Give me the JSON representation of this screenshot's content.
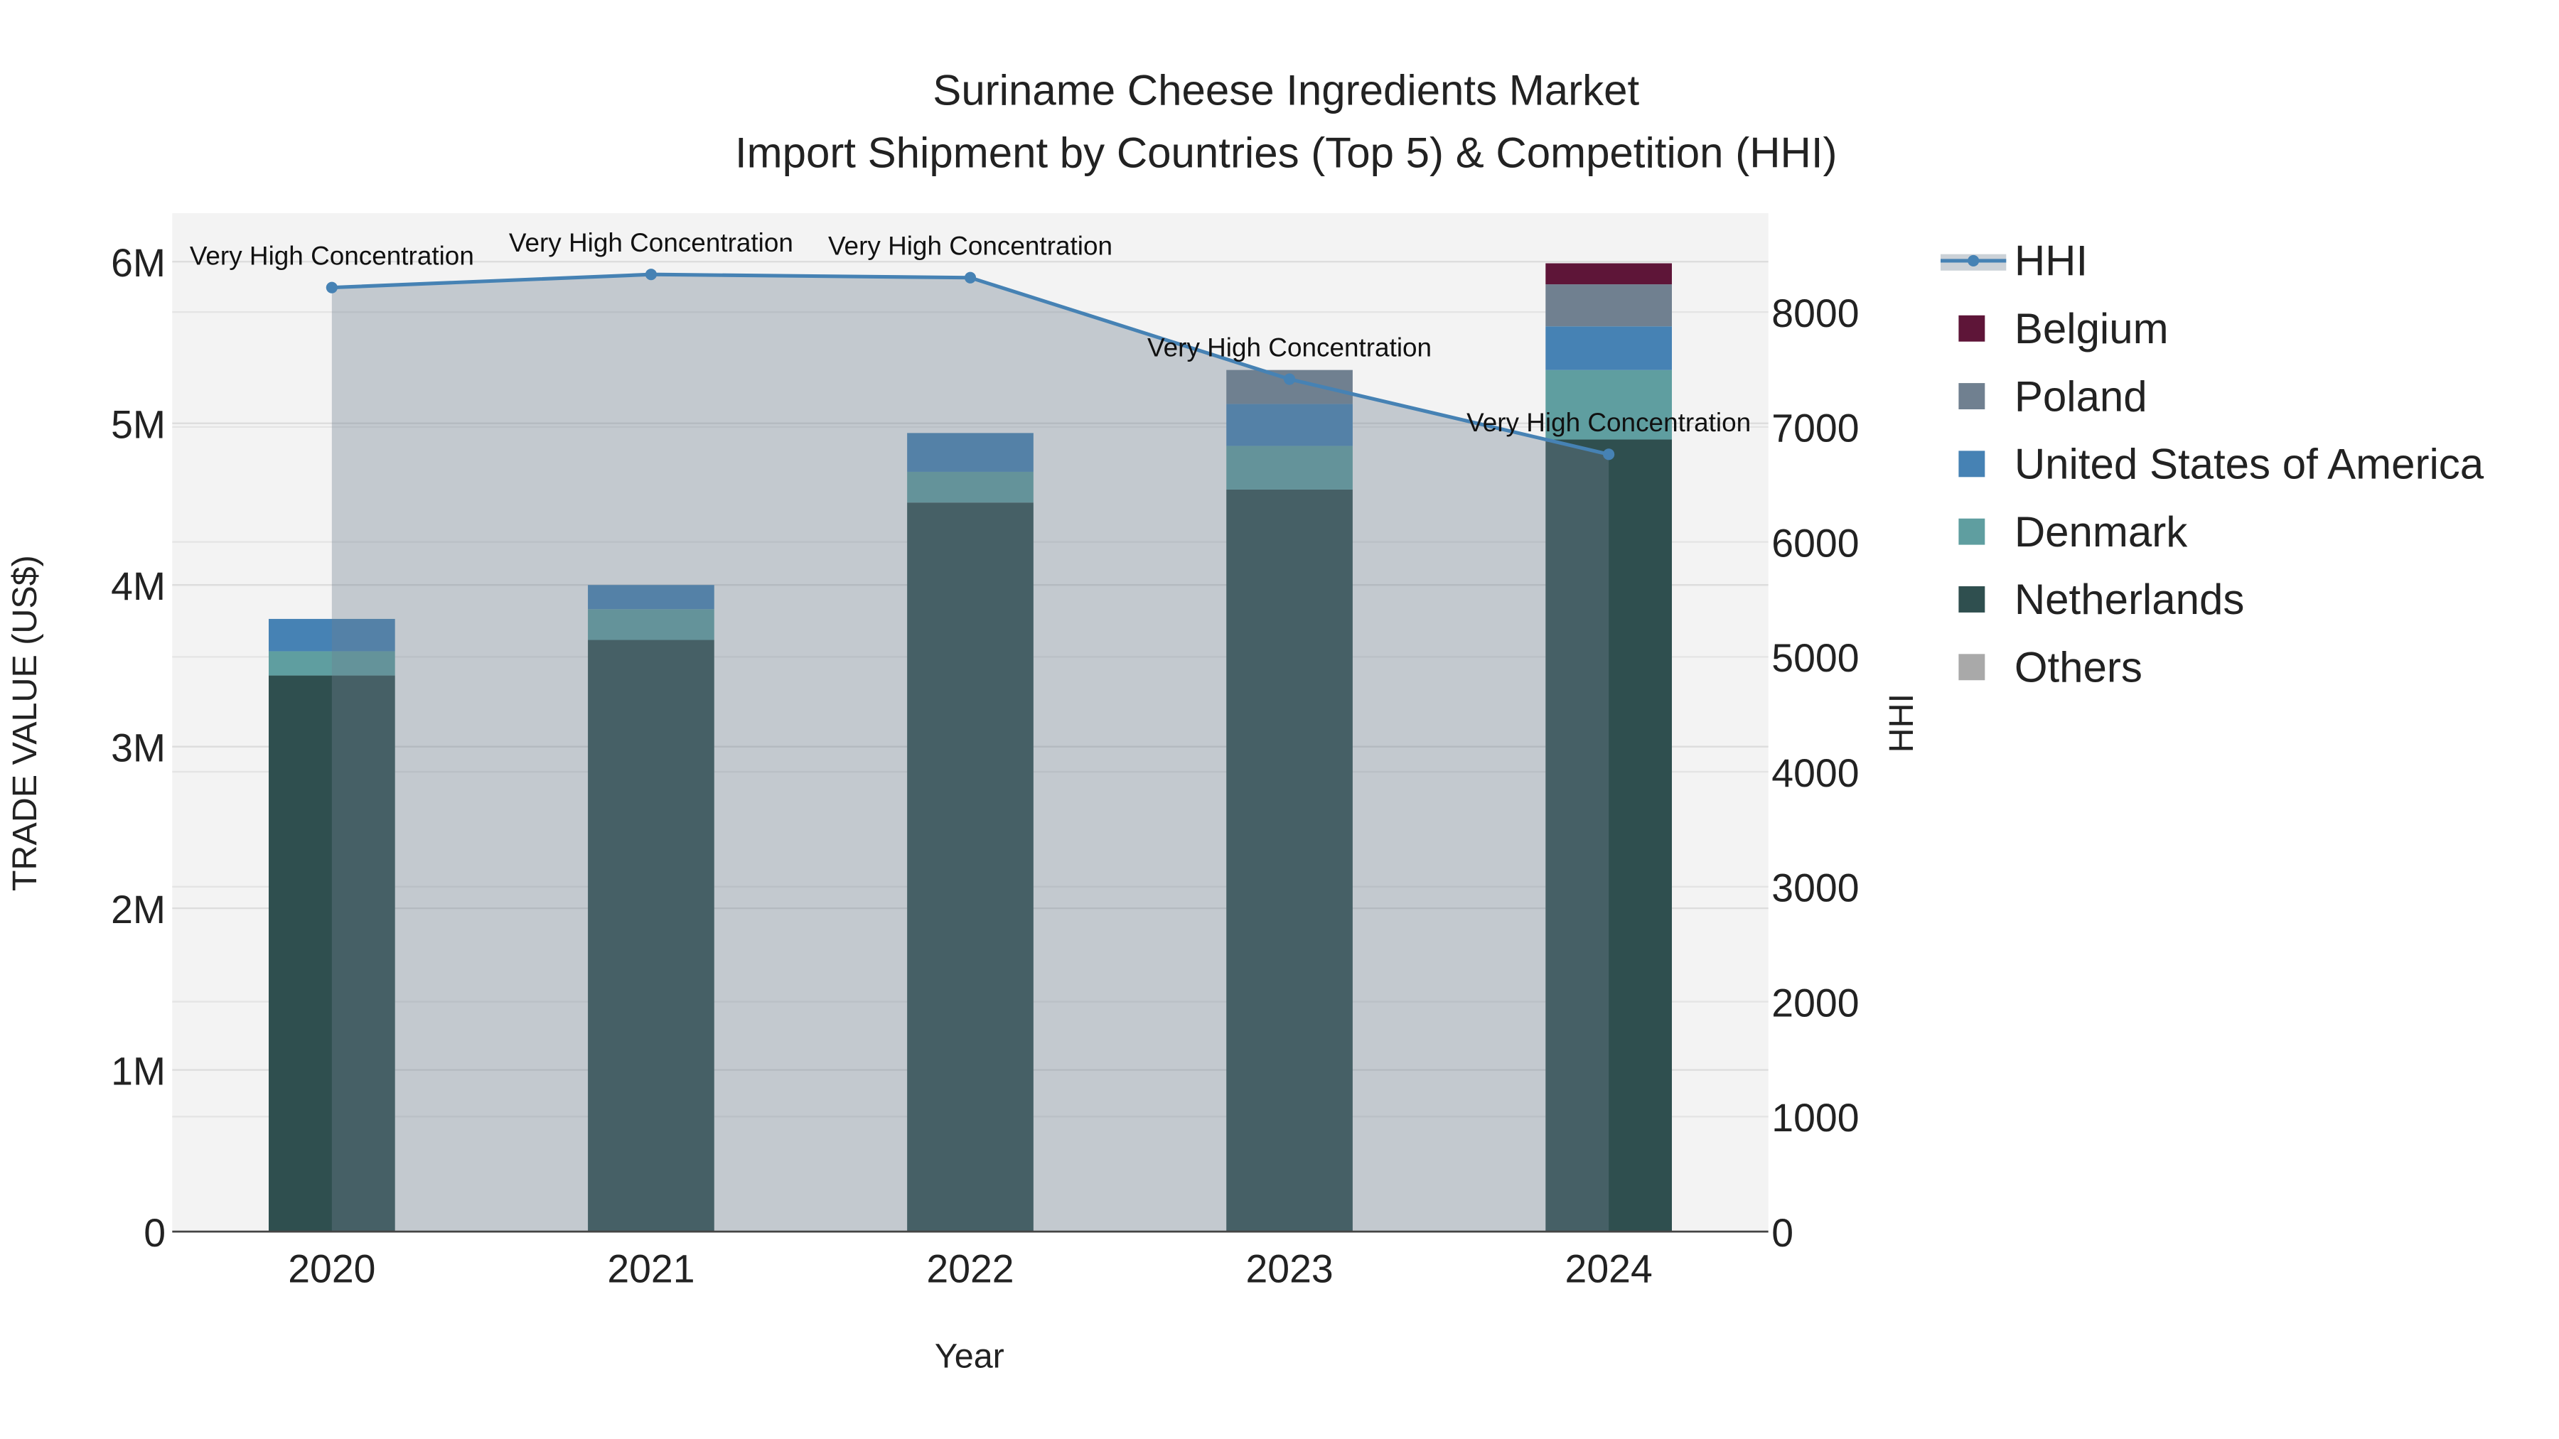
{
  "chart_data": {
    "type": "bar",
    "title": "Suriname Cheese Ingredients Market",
    "subtitle": "Import Shipment by Countries (Top 5) & Competition (HHI)",
    "xlabel": "Year",
    "ylabel": "TRADE VALUE (US$)",
    "y2label": "HHI",
    "barmode": "stack",
    "categories": [
      "2020",
      "2021",
      "2022",
      "2023",
      "2024"
    ],
    "ylim": [
      0,
      6300000
    ],
    "y2lim": [
      0,
      8860
    ],
    "yticks": [
      {
        "v": 0,
        "label": "0"
      },
      {
        "v": 1000000,
        "label": "1M"
      },
      {
        "v": 2000000,
        "label": "2M"
      },
      {
        "v": 3000000,
        "label": "3M"
      },
      {
        "v": 4000000,
        "label": "4M"
      },
      {
        "v": 5000000,
        "label": "5M"
      },
      {
        "v": 6000000,
        "label": "6M"
      }
    ],
    "y2ticks": [
      {
        "v": 0,
        "label": "0"
      },
      {
        "v": 1000,
        "label": "1000"
      },
      {
        "v": 2000,
        "label": "2000"
      },
      {
        "v": 3000,
        "label": "3000"
      },
      {
        "v": 4000,
        "label": "4000"
      },
      {
        "v": 5000,
        "label": "5000"
      },
      {
        "v": 6000,
        "label": "6000"
      },
      {
        "v": 7000,
        "label": "7000"
      },
      {
        "v": 8000,
        "label": "8000"
      }
    ],
    "series": [
      {
        "name": "Netherlands",
        "color": "#2F4F4F",
        "values": [
          3440000,
          3660000,
          4510000,
          4590000,
          4900000
        ]
      },
      {
        "name": "Denmark",
        "color": "#5F9EA0",
        "values": [
          150000,
          190000,
          190000,
          270000,
          430000
        ]
      },
      {
        "name": "United States of America",
        "color": "#4682B4",
        "values": [
          200000,
          150000,
          240000,
          260000,
          270000
        ]
      },
      {
        "name": "Poland",
        "color": "#708090",
        "values": [
          0,
          0,
          0,
          210000,
          260000
        ]
      },
      {
        "name": "Belgium",
        "color": "#5E1538",
        "values": [
          0,
          0,
          0,
          0,
          130000
        ]
      },
      {
        "name": "Others",
        "color": "#A9A9A9",
        "values": [
          0,
          0,
          0,
          0,
          0
        ]
      }
    ],
    "hhi": {
      "name": "HHI",
      "color": "#4682B4",
      "values": [
        8213,
        8327,
        8299,
        7416,
        6762
      ],
      "annotations": [
        "Very High Concentration",
        "Very High Concentration",
        "Very High Concentration",
        "Very High Concentration",
        "Very High Concentration"
      ]
    },
    "legend_order": [
      "HHI",
      "Belgium",
      "Poland",
      "United States of America",
      "Denmark",
      "Netherlands",
      "Others"
    ],
    "legend_position": "right",
    "grid": true
  }
}
